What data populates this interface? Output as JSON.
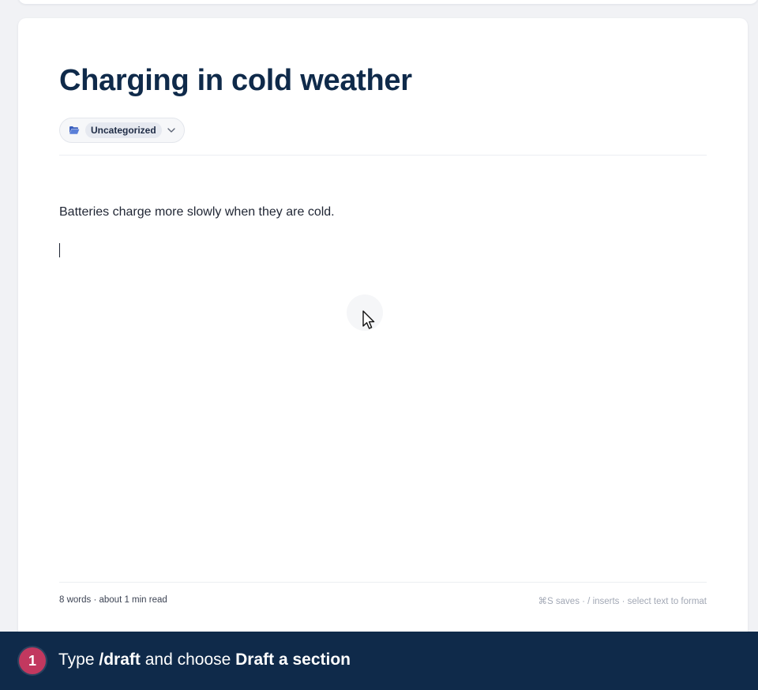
{
  "editor": {
    "title": "Charging in cold weather",
    "category": {
      "label": "Uncategorized",
      "icon": "folder-open-icon",
      "dropdown_icon": "chevron-down-icon"
    },
    "body": {
      "paragraph": "Batteries charge more slowly when they are cold."
    },
    "footer": {
      "word_count": "8 words · about 1 min read",
      "hints": "⌘S saves · / inserts · select text to format"
    }
  },
  "tutorial": {
    "step_number": "1",
    "instruction_prefix": "Type ",
    "instruction_command": "/draft",
    "instruction_middle": " and choose ",
    "instruction_target": "Draft a section"
  },
  "colors": {
    "banner_bg": "#0f2a4a",
    "step_badge": "#c2385f",
    "title": "#0f2a4a",
    "folder_icon": "#3a5fbf"
  }
}
